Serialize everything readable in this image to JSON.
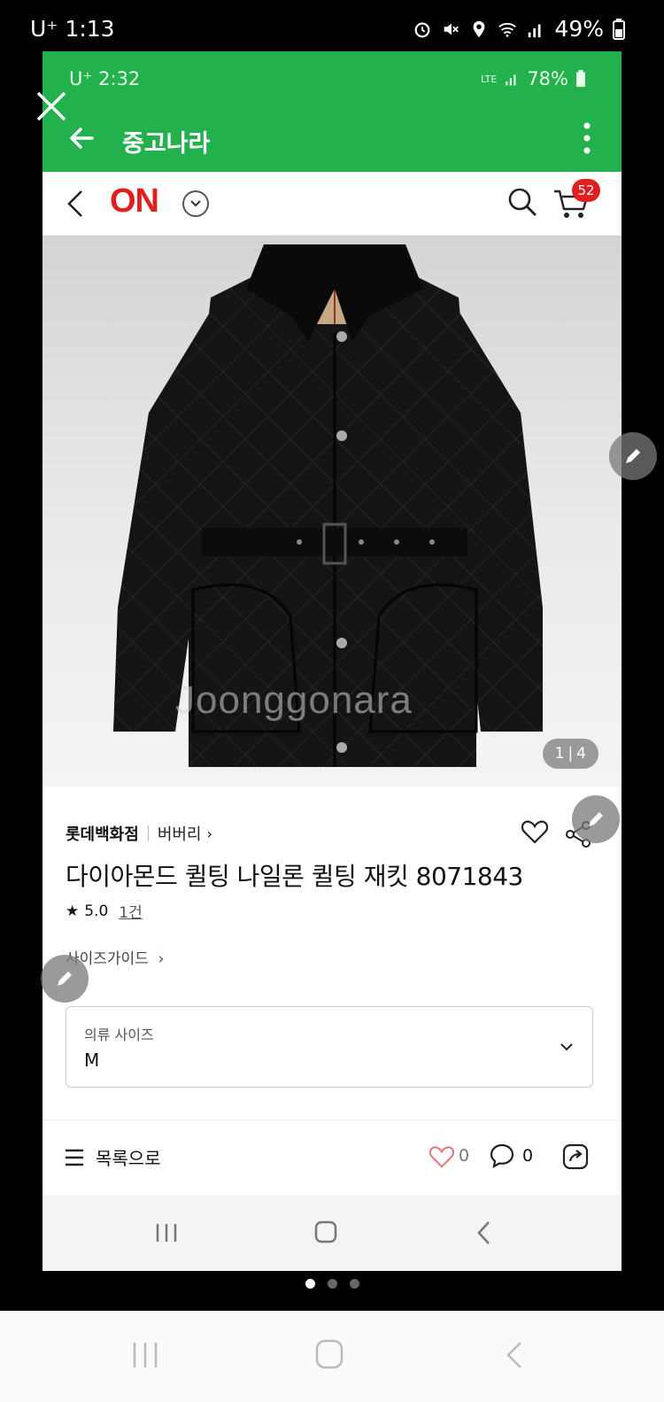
{
  "outer_status": {
    "carrier": "U⁺ 1:13",
    "battery": "49%"
  },
  "inner_status": {
    "carrier": "U⁺ 2:32",
    "network": "LTE",
    "battery": "78%"
  },
  "app_bar": {
    "title": "중고나라"
  },
  "on_header": {
    "logo": "ON",
    "cart_badge": "52"
  },
  "product_image": {
    "counter_current": "1",
    "counter_total": "4",
    "watermark": "Joonggonara"
  },
  "product": {
    "store": "롯데백화점",
    "brand": "버버리",
    "title": "다이아몬드 퀼팅 나일론 퀼팅 재킷 8071843",
    "rating": "5.0",
    "review_count": "1건",
    "size_guide": "사이즈가이드"
  },
  "size_select": {
    "label": "의류 사이즈",
    "value": "M"
  },
  "bottom_bar": {
    "list_label": "목록으로",
    "like_count": "0",
    "comment_count": "0"
  },
  "pager": {
    "total": 3,
    "active": 0
  },
  "colors": {
    "green": "#22b14c",
    "red": "#e02020"
  }
}
